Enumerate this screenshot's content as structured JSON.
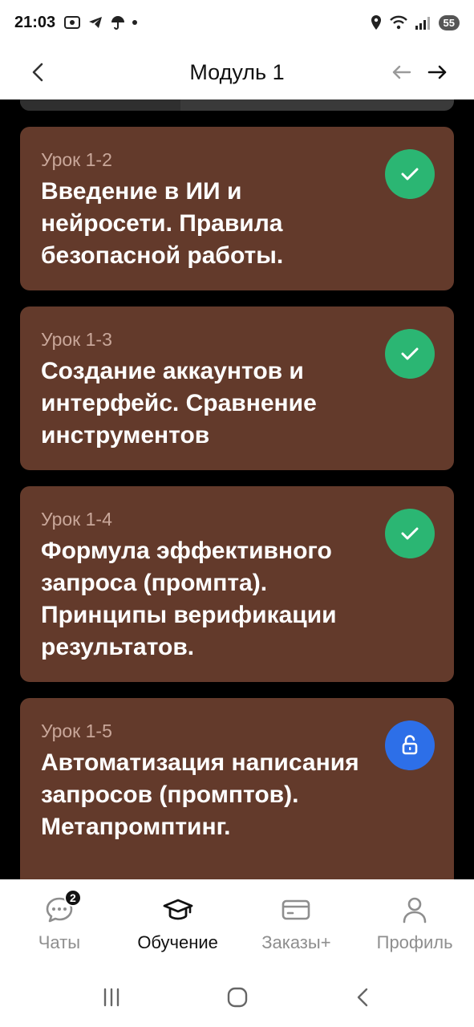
{
  "status_bar": {
    "time": "21:03",
    "battery": "55"
  },
  "header": {
    "title": "Модуль 1"
  },
  "lessons": [
    {
      "label": "Урок 1-2",
      "title": "Введение в ИИ и нейросети. Правила безопасной работы.",
      "status": "completed"
    },
    {
      "label": "Урок 1-3",
      "title": "Создание аккаунтов и интерфейс. Сравнение инструментов",
      "status": "completed"
    },
    {
      "label": "Урок 1-4",
      "title": "Формула эффективного запроса (промпта). Принципы верификации результатов.",
      "status": "completed"
    },
    {
      "label": "Урок 1-5",
      "title": "Автоматизация написания запросов (промптов). Метапромптинг.",
      "status": "unlocked"
    }
  ],
  "bottom_nav": {
    "items": [
      {
        "label": "Чаты",
        "icon": "chat-icon",
        "badge": "2",
        "active": false
      },
      {
        "label": "Обучение",
        "icon": "graduation-cap-icon",
        "active": true
      },
      {
        "label": "Заказы+",
        "icon": "card-icon",
        "active": false
      },
      {
        "label": "Профиль",
        "icon": "profile-icon",
        "active": false
      }
    ]
  },
  "colors": {
    "card_bg": "#633a2b",
    "label": "#c9a79a",
    "completed": "#2bb673",
    "unlocked": "#2d6fe8"
  }
}
